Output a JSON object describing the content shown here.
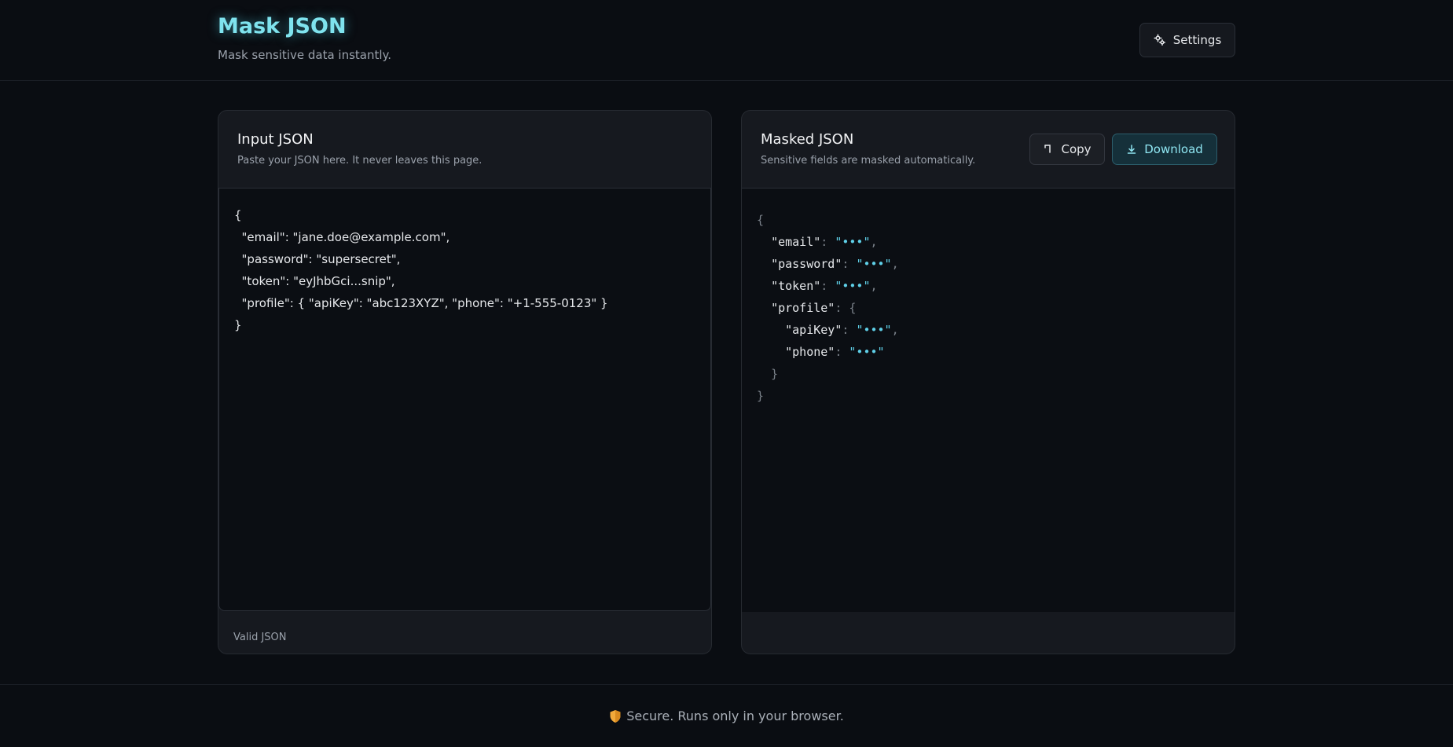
{
  "header": {
    "title": "Mask JSON",
    "subtitle": "Mask sensitive data instantly.",
    "settings_label": "Settings"
  },
  "input_panel": {
    "title": "Input JSON",
    "subtitle": "Paste your JSON here. It never leaves this page.",
    "value": "{\n  \"email\": \"jane.doe@example.com\",\n  \"password\": \"supersecret\",\n  \"token\": \"eyJhbGci...snip\",\n  \"profile\": { \"apiKey\": \"abc123XYZ\", \"phone\": \"+1-555-0123\" }\n}",
    "status": "Valid JSON"
  },
  "output_panel": {
    "title": "Masked JSON",
    "subtitle": "Sensitive fields are masked automatically.",
    "copy_label": "Copy",
    "download_label": "Download",
    "lines": {
      "open": "{",
      "email_key": "\"email\"",
      "password_key": "\"password\"",
      "token_key": "\"token\"",
      "profile_key": "\"profile\"",
      "apikey_key": "\"apiKey\"",
      "phone_key": "\"phone\"",
      "mask": "\"•••\"",
      "colon": ": ",
      "comma": ",",
      "inner_open": "{",
      "inner_close": "}",
      "close": "}"
    }
  },
  "footer": {
    "icon": "shield-icon",
    "text": "Secure. Runs only in your browser."
  },
  "colors": {
    "accent": "#7fe3ee",
    "mask": "#5fd0e8",
    "background": "#0a0d12",
    "panel": "#16191f"
  }
}
